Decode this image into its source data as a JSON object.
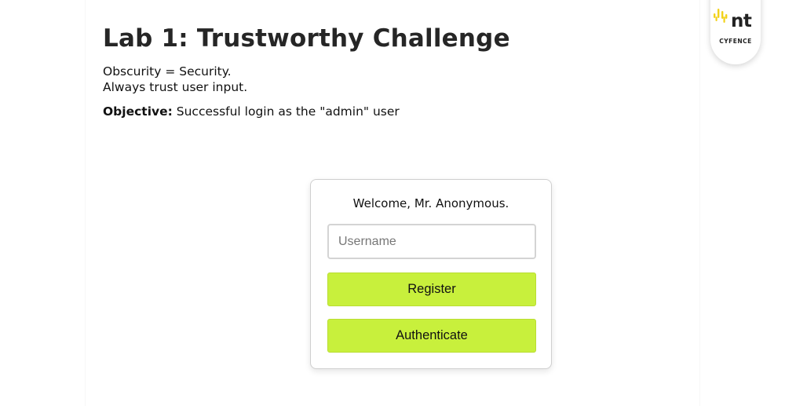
{
  "header": {
    "title": "Lab 1: Trustworthy Challenge",
    "description_lines": [
      "Obscurity = Security.",
      "Always trust user input."
    ],
    "objective_label": "Objective:",
    "objective_text": " Successful login as the \"admin\" user"
  },
  "login": {
    "welcome": "Welcome, Mr. Anonymous.",
    "username_placeholder": "Username",
    "username_value": "",
    "register_label": "Register",
    "authenticate_label": "Authenticate"
  },
  "brand": {
    "logo_icon": "signal-bars-icon",
    "logo_text": "nt",
    "logo_subtext": "CYFENCE",
    "accent_color": "#c8f03c",
    "logo_yellow": "#f2d21b"
  }
}
